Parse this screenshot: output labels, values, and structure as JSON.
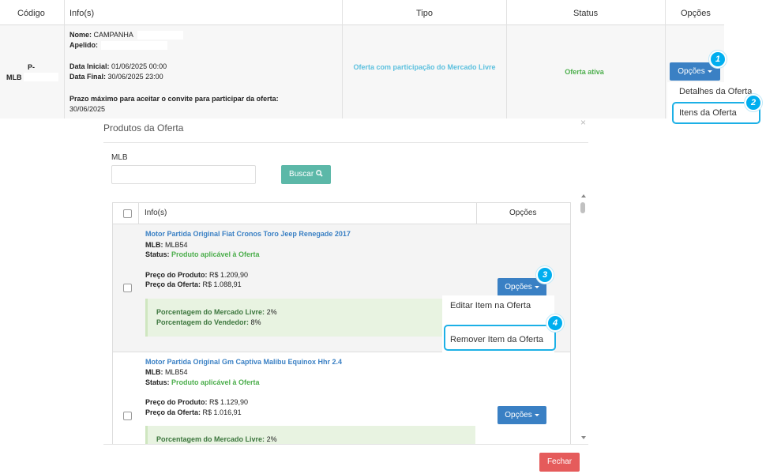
{
  "top_table": {
    "headers": {
      "codigo": "Código",
      "infos": "Info(s)",
      "tipo": "Tipo",
      "status": "Status",
      "opcoes": "Opções"
    },
    "row": {
      "code_line1": "P-",
      "code_line2": "MLB",
      "nome_label": "Nome:",
      "nome_value": "CAMPANHA",
      "apelido_label": "Apelido:",
      "data_inicial_label": "Data Inicial:",
      "data_inicial_value": "01/06/2025 00:00",
      "data_final_label": "Data Final:",
      "data_final_value": "30/06/2025 23:00",
      "prazo_label": "Prazo máximo para aceitar o convite para participar da oferta:",
      "prazo_value": "30/06/2025",
      "tipo": "Oferta com participação do Mercado Livre",
      "status": "Oferta ativa",
      "opcoes_button": "Opções",
      "dropdown": [
        "Detalhes da Oferta",
        "Itens da Oferta"
      ]
    }
  },
  "badges": [
    "1",
    "2",
    "3",
    "4"
  ],
  "modal": {
    "title": "Produtos da Oferta",
    "close": "×",
    "mlb_label": "MLB",
    "search_placeholder": "",
    "buscar": "Buscar",
    "table_headers": {
      "infos": "Info(s)",
      "opcoes": "Opções"
    },
    "products": [
      {
        "title": "Motor Partida Original Fiat Cronos Toro Jeep Renegade 2017",
        "mlb_label": "MLB:",
        "mlb_value": "MLB54",
        "status_label": "Status:",
        "status_value": "Produto aplicável à Oferta",
        "preco_produto_label": "Preço do Produto:",
        "preco_produto_value": "R$ 1.209,90",
        "preco_oferta_label": "Preço da Oferta:",
        "preco_oferta_value": "R$ 1.088,91",
        "pct_ml_label": "Porcentagem do Mercado Livre:",
        "pct_ml_value": "2%",
        "pct_vend_label": "Porcentagem do Vendedor:",
        "pct_vend_value": "8%",
        "opcoes_button": "Opções",
        "dropdown": [
          "Editar Item na Oferta",
          "Remover Item da Oferta"
        ]
      },
      {
        "title": "Motor Partida Original Gm Captiva Malibu Equinox Hhr 2.4",
        "mlb_label": "MLB:",
        "mlb_value": "MLB54",
        "status_label": "Status:",
        "status_value": "Produto aplicável à Oferta",
        "preco_produto_label": "Preço do Produto:",
        "preco_produto_value": "R$ 1.129,90",
        "preco_oferta_label": "Preço da Oferta:",
        "preco_oferta_value": "R$ 1.016,91",
        "pct_ml_label": "Porcentagem do Mercado Livre:",
        "pct_ml_value": "2%",
        "opcoes_button": "Opções"
      }
    ],
    "fechar": "Fechar"
  },
  "colors": {
    "accent_blue": "#3a80c4",
    "teal_button": "#5cb8a8",
    "green_text": "#4cae4c",
    "close_red": "#e55b5b",
    "badge": "#00aeef"
  }
}
